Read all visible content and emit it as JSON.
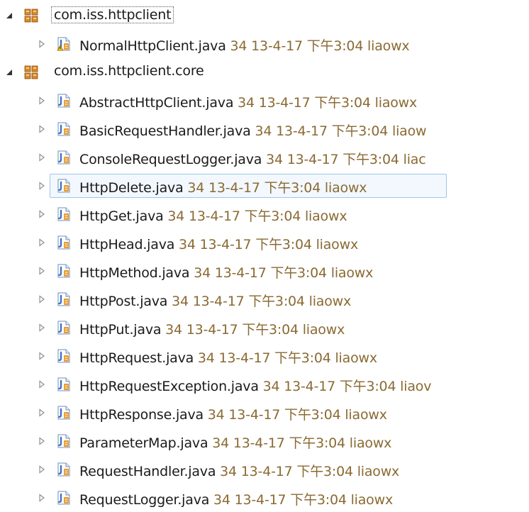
{
  "tree": {
    "packages": [
      {
        "name": "com.iss.httpclient",
        "expanded": true,
        "focused": true,
        "files": [
          {
            "name": "NormalHttpClient.java",
            "revision": "34",
            "date": "13-4-17",
            "time": "下午3:04",
            "author": "liaowx",
            "warning": true
          }
        ]
      },
      {
        "name": "com.iss.httpclient.core",
        "expanded": true,
        "focused": false,
        "files": [
          {
            "name": "AbstractHttpClient.java",
            "revision": "34",
            "date": "13-4-17",
            "time": "下午3:04",
            "author": "liaowx"
          },
          {
            "name": "BasicRequestHandler.java",
            "revision": "34",
            "date": "13-4-17",
            "time": "下午3:04",
            "author": "liaow"
          },
          {
            "name": "ConsoleRequestLogger.java",
            "revision": "34",
            "date": "13-4-17",
            "time": "下午3:04",
            "author": "liac"
          },
          {
            "name": "HttpDelete.java",
            "revision": "34",
            "date": "13-4-17",
            "time": "下午3:04",
            "author": "liaowx",
            "selected": true
          },
          {
            "name": "HttpGet.java",
            "revision": "34",
            "date": "13-4-17",
            "time": "下午3:04",
            "author": "liaowx"
          },
          {
            "name": "HttpHead.java",
            "revision": "34",
            "date": "13-4-17",
            "time": "下午3:04",
            "author": "liaowx"
          },
          {
            "name": "HttpMethod.java",
            "revision": "34",
            "date": "13-4-17",
            "time": "下午3:04",
            "author": "liaowx"
          },
          {
            "name": "HttpPost.java",
            "revision": "34",
            "date": "13-4-17",
            "time": "下午3:04",
            "author": "liaowx"
          },
          {
            "name": "HttpPut.java",
            "revision": "34",
            "date": "13-4-17",
            "time": "下午3:04",
            "author": "liaowx"
          },
          {
            "name": "HttpRequest.java",
            "revision": "34",
            "date": "13-4-17",
            "time": "下午3:04",
            "author": "liaowx"
          },
          {
            "name": "HttpRequestException.java",
            "revision": "34",
            "date": "13-4-17",
            "time": "下午3:04",
            "author": "liaov"
          },
          {
            "name": "HttpResponse.java",
            "revision": "34",
            "date": "13-4-17",
            "time": "下午3:04",
            "author": "liaowx"
          },
          {
            "name": "ParameterMap.java",
            "revision": "34",
            "date": "13-4-17",
            "time": "下午3:04",
            "author": "liaowx"
          },
          {
            "name": "RequestHandler.java",
            "revision": "34",
            "date": "13-4-17",
            "time": "下午3:04",
            "author": "liaowx"
          },
          {
            "name": "RequestLogger.java",
            "revision": "34",
            "date": "13-4-17",
            "time": "下午3:04",
            "author": "liaowx"
          }
        ]
      }
    ],
    "icons": {
      "package": "package-icon",
      "java_file": "java-file-icon",
      "expanded": "expanded-triangle-icon",
      "collapsed": "collapsed-triangle-icon",
      "warning": "warning-overlay-icon"
    },
    "colors": {
      "meta_text": "#8a6a33",
      "selection_border": "#9ec6ea",
      "selection_fill": "#f2f8fd",
      "java_icon_blue": "#3f74c4",
      "java_icon_orange": "#e99a2b",
      "package_orange": "#d9882a"
    }
  }
}
